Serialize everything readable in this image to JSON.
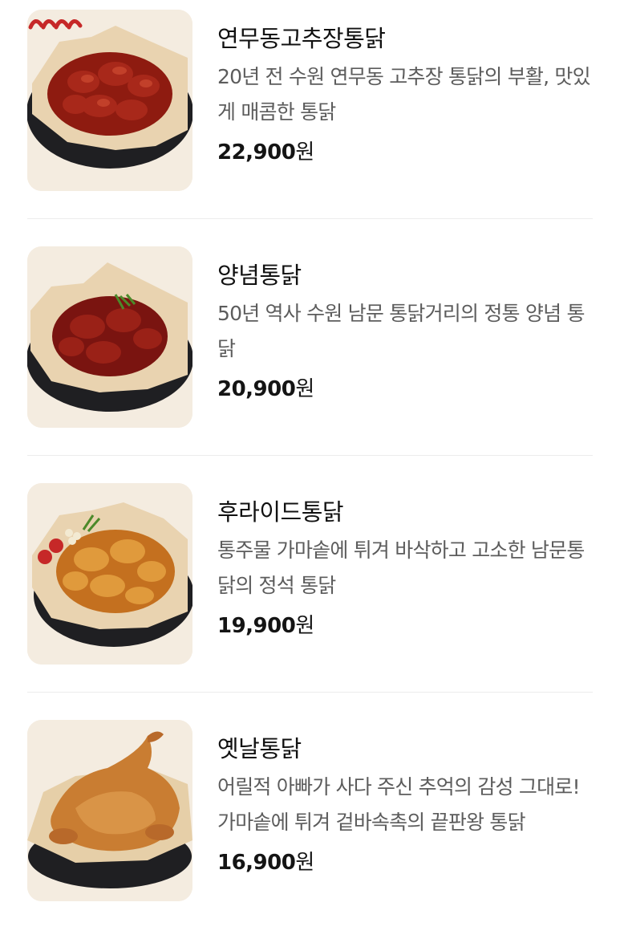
{
  "menu": {
    "items": [
      {
        "name": "연무동고추장통닭",
        "description": "20년 전 수원 연무동 고추장 통닭의 부활, 맛있게 매콤한 통닭",
        "price": "22,900",
        "currency": "원",
        "image_icon": "spicy-gochujang-chicken-image",
        "spice_icon": "chili-pepper-icon"
      },
      {
        "name": "양념통닭",
        "description": "50년 역사 수원 남문 통닭거리의 정통 양념 통닭",
        "price": "20,900",
        "currency": "원",
        "image_icon": "seasoned-chicken-image"
      },
      {
        "name": "후라이드통닭",
        "description": "통주물 가마솥에 튀겨 바삭하고 고소한 남문통닭의 정석 통닭",
        "price": "19,900",
        "currency": "원",
        "image_icon": "fried-chicken-image"
      },
      {
        "name": "옛날통닭",
        "description": "어릴적 아빠가 사다 주신 추억의 감성 그대로! 가마솥에 튀겨 겉바속촉의 끝판왕 통닭",
        "price": "16,900",
        "currency": "원",
        "image_icon": "whole-fried-chicken-image"
      }
    ]
  },
  "colors": {
    "thumb_background": "#f4ece0",
    "pan": "#1f1f22",
    "paper": "#e9d3b0",
    "spicy_sauce": "#9c1f12",
    "fried": "#d98a2f",
    "chili": "#c62828"
  }
}
